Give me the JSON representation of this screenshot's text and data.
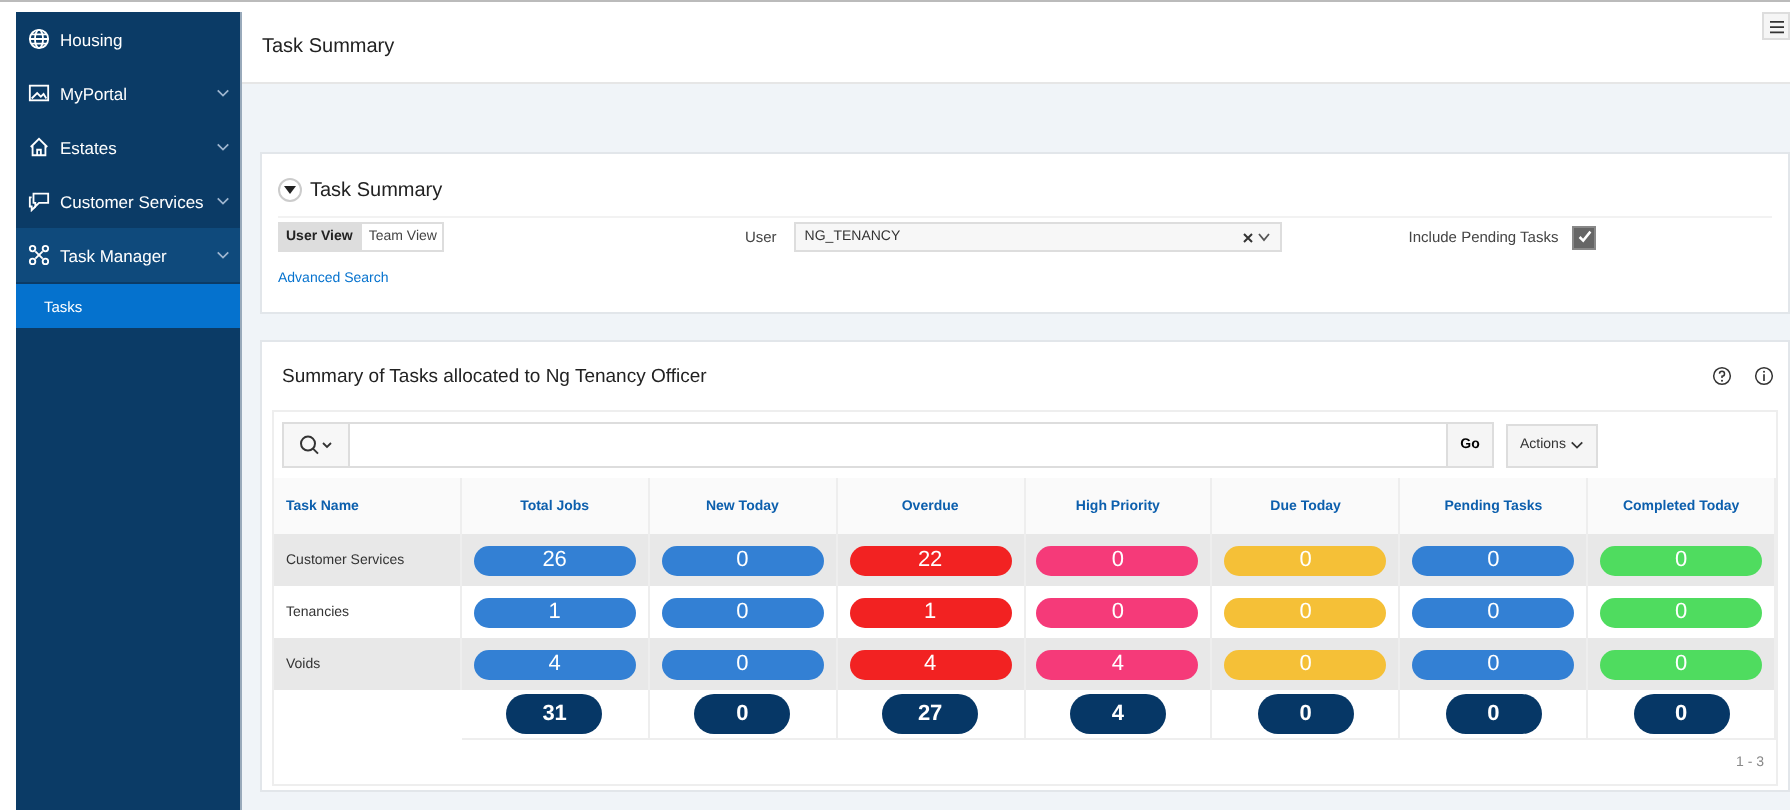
{
  "sidebar": {
    "items": [
      {
        "label": "Housing",
        "expandable": false,
        "expanded": false,
        "selected": false
      },
      {
        "label": "MyPortal",
        "expandable": true,
        "expanded": false,
        "selected": false
      },
      {
        "label": "Estates",
        "expandable": true,
        "expanded": false,
        "selected": false
      },
      {
        "label": "Customer Services",
        "expandable": true,
        "expanded": false,
        "selected": false
      },
      {
        "label": "Task Manager",
        "expandable": true,
        "expanded": true,
        "selected": false,
        "children": [
          {
            "label": "Tasks",
            "selected": true
          }
        ]
      }
    ]
  },
  "page_title": "Task Summary",
  "search_region": {
    "title": "Task Summary",
    "expanded": true,
    "view_toggle": [
      {
        "label": "User View",
        "selected": true
      },
      {
        "label": "Team View",
        "selected": false
      }
    ],
    "user_label": "User",
    "user_value": "NG_TENANCY",
    "pending_label": "Include Pending Tasks",
    "pending_checked": true,
    "advanced_link": "Advanced Search"
  },
  "report": {
    "title": "Summary of Tasks allocated to Ng Tenancy Officer",
    "go_button": "Go",
    "actions_button": "Actions",
    "columns": [
      {
        "label": "Task Name"
      },
      {
        "label": "Total Jobs",
        "color": "#3380d4"
      },
      {
        "label": "New Today",
        "color": "#3380d4"
      },
      {
        "label": "Overdue",
        "color": "#f22222"
      },
      {
        "label": "High Priority",
        "color": "#f53a79"
      },
      {
        "label": "Due Today",
        "color": "#f5c037"
      },
      {
        "label": "Pending Tasks",
        "color": "#3380d4"
      },
      {
        "label": "Completed Today",
        "color": "#4fdc5f"
      }
    ],
    "rows": [
      {
        "name": "Customer Services",
        "values": [
          "26",
          "0",
          "22",
          "0",
          "0",
          "0",
          "0"
        ]
      },
      {
        "name": "Tenancies",
        "values": [
          "1",
          "0",
          "1",
          "0",
          "0",
          "0",
          "0"
        ]
      },
      {
        "name": "Voids",
        "values": [
          "4",
          "0",
          "4",
          "4",
          "0",
          "0",
          "0"
        ]
      }
    ],
    "totals": [
      "31",
      "0",
      "27",
      "4",
      "0",
      "0",
      "0"
    ],
    "pagination": "1 - 3"
  }
}
